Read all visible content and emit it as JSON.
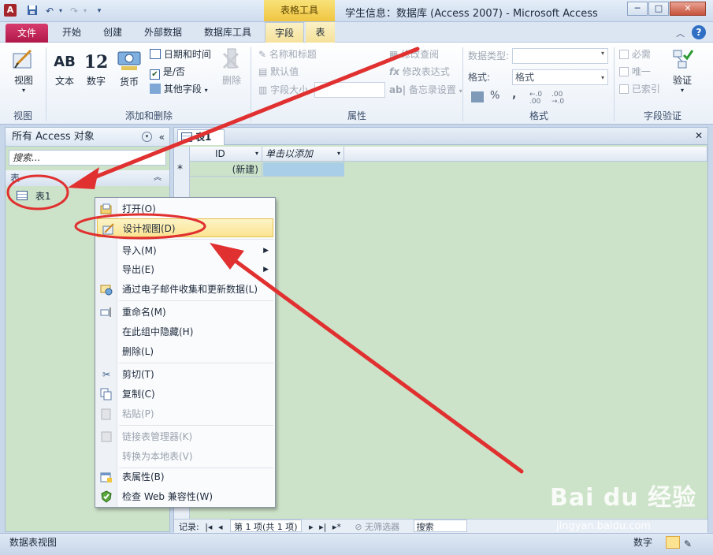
{
  "titlebar": {
    "app_icon": "A",
    "context_group": "表格工具",
    "title": "学生信息：数据库 (Access 2007) - Microsoft Access",
    "minimize": "─",
    "maximize": "□",
    "close": "✕"
  },
  "tabs": {
    "file": "文件",
    "home": "开始",
    "create": "创建",
    "external": "外部数据",
    "dbtools": "数据库工具",
    "fields": "字段",
    "table": "表"
  },
  "ribbon": {
    "view_group": {
      "label": "视图",
      "view_btn": "视图"
    },
    "add_group": {
      "label": "添加和删除",
      "text": "文本",
      "text_icon": "AB",
      "number": "数字",
      "number_icon": "12",
      "currency": "货币",
      "datetime": "日期和时间",
      "yesno": "是/否",
      "more": "其他字段",
      "delete": "删除"
    },
    "props_group": {
      "label": "属性",
      "name_caption": "名称和标题",
      "default": "默认值",
      "field_size": "字段大小",
      "modify_lookup": "修改查阅",
      "modify_expr": "修改表达式",
      "memo_settings": "备忘录设置"
    },
    "format_group": {
      "label": "格式",
      "data_type_label": "数据类型:",
      "format_label": "格式:",
      "format_value": "格式",
      "percent": "%",
      "comma": ",",
      "inc_dec": "←.0 .00",
      "dec_dec": ".00 →.0"
    },
    "validation_group": {
      "label": "字段验证",
      "required": "必需",
      "unique": "唯一",
      "indexed": "已索引",
      "validate": "验证"
    }
  },
  "nav": {
    "header": "所有 Access 对象",
    "search_placeholder": "搜索...",
    "group": "表",
    "items": [
      {
        "label": "表1"
      }
    ]
  },
  "doc": {
    "tab": "表1",
    "columns": [
      "ID",
      "单击以添加"
    ],
    "new_row_marker": "*",
    "new_row_value": "(新建)",
    "record_nav": {
      "label": "记录:",
      "position": "第 1 项(共 1 项)",
      "filter": "无筛选器",
      "search": "搜索"
    }
  },
  "context_menu": {
    "items": [
      {
        "label": "打开(O)",
        "icon": "open-icon",
        "disabled": false
      },
      {
        "label": "设计视图(D)",
        "icon": "design-view-icon",
        "disabled": false,
        "highlighted": true
      },
      {
        "label": "导入(M)",
        "submenu": true,
        "disabled": false
      },
      {
        "label": "导出(E)",
        "submenu": true,
        "disabled": false
      },
      {
        "label": "通过电子邮件收集和更新数据(L)",
        "icon": "email-collect-icon",
        "disabled": false
      },
      {
        "label": "重命名(M)",
        "icon": "rename-icon",
        "disabled": false
      },
      {
        "label": "在此组中隐藏(H)",
        "disabled": false
      },
      {
        "label": "删除(L)",
        "disabled": false
      },
      {
        "label": "剪切(T)",
        "icon": "cut-icon",
        "disabled": false
      },
      {
        "label": "复制(C)",
        "icon": "copy-icon",
        "disabled": false
      },
      {
        "label": "粘贴(P)",
        "icon": "paste-icon",
        "disabled": true
      },
      {
        "label": "链接表管理器(K)",
        "icon": "linked-table-icon",
        "disabled": true
      },
      {
        "label": "转换为本地表(V)",
        "disabled": true
      },
      {
        "label": "表属性(B)",
        "icon": "table-properties-icon",
        "disabled": false
      },
      {
        "label": "检查 Web 兼容性(W)",
        "icon": "web-check-icon",
        "disabled": false
      }
    ]
  },
  "statusbar": {
    "left": "数据表视图",
    "right": "数字"
  },
  "watermark": {
    "brand": "Bai du 经验",
    "url": "jingyan.baidu.com"
  },
  "colors": {
    "file_tab": "#c41a4c",
    "context_tab": "#f0c540",
    "annotation_red": "#e03030",
    "datasheet_bg": "#cde3c9"
  }
}
